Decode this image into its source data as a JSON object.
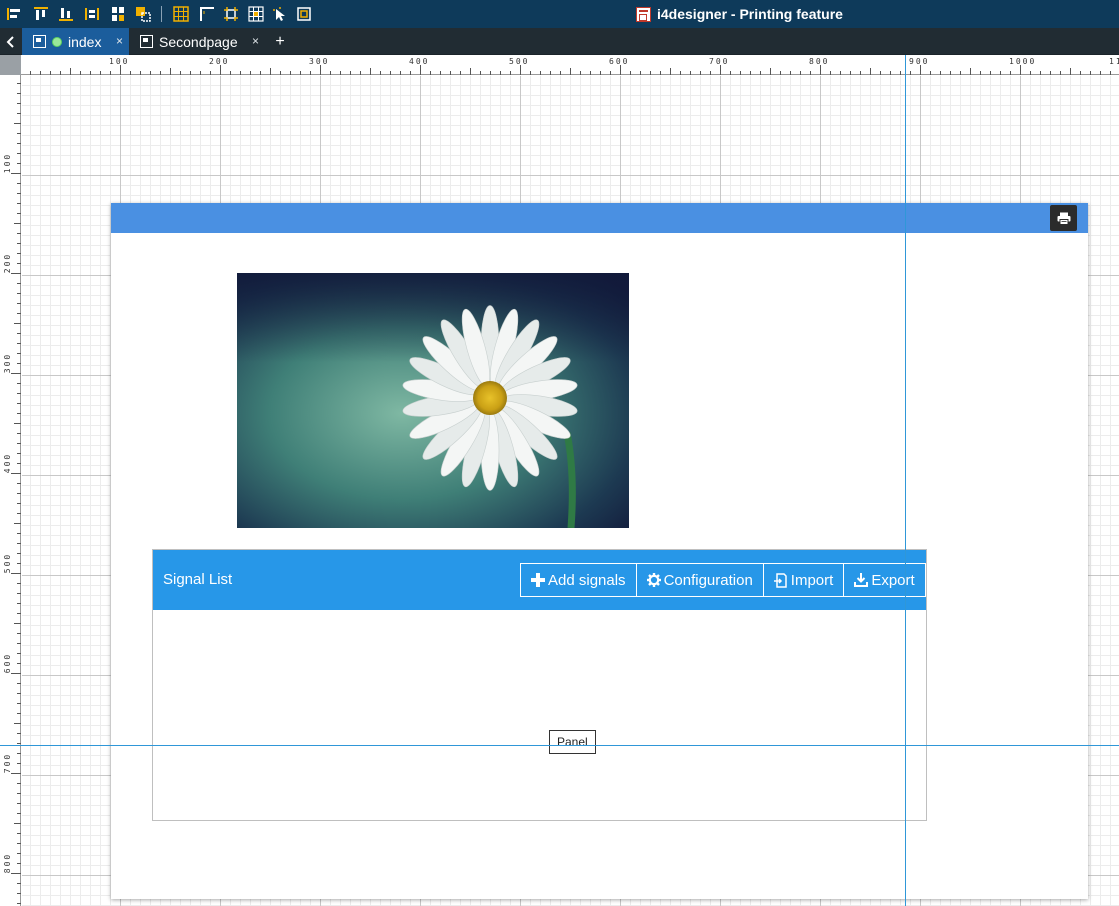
{
  "app": {
    "title": "i4designer - Printing feature",
    "colors": {
      "toolbar": "#0e3a5a",
      "tabbar": "#212c33",
      "active_tab": "#1b5d9c",
      "tool_icons": "#f0b000",
      "page_header": "#4a90e2",
      "signal_header": "#2797e8",
      "guide": "#2f97d8"
    }
  },
  "toolbar": {
    "icons": [
      "align-left-icon",
      "align-top-icon",
      "align-bottom-icon",
      "distribute-horizontal-icon",
      "distribute-vertical-icon",
      "group-icon",
      "grid-icon",
      "corner-icon",
      "snap-icon",
      "grid-snap-icon",
      "select-icon",
      "fit-icon"
    ]
  },
  "tabs": {
    "back_icon": "chevron-left-icon",
    "items": [
      {
        "label": "index",
        "close": "×",
        "active": true,
        "status": "online"
      },
      {
        "label": "Secondpage",
        "close": "×",
        "active": false
      }
    ],
    "add_label": "+"
  },
  "ruler": {
    "h_labels": [
      "100",
      "200",
      "300",
      "400",
      "500",
      "600",
      "700",
      "800",
      "900",
      "1000",
      "11"
    ],
    "v_labels": [
      "100",
      "200",
      "300",
      "400",
      "500",
      "600",
      "700",
      "800"
    ]
  },
  "page": {
    "print_icon": "printer-icon",
    "image_subject": "daisy-photo"
  },
  "signal_list": {
    "title": "Signal List",
    "buttons": [
      {
        "label": "Add signals",
        "icon": "plus-icon"
      },
      {
        "label": "Configuration",
        "icon": "gear-icon"
      },
      {
        "label": "Import",
        "icon": "import-icon"
      },
      {
        "label": "Export",
        "icon": "download-icon"
      }
    ],
    "panel_label": "Panel"
  }
}
